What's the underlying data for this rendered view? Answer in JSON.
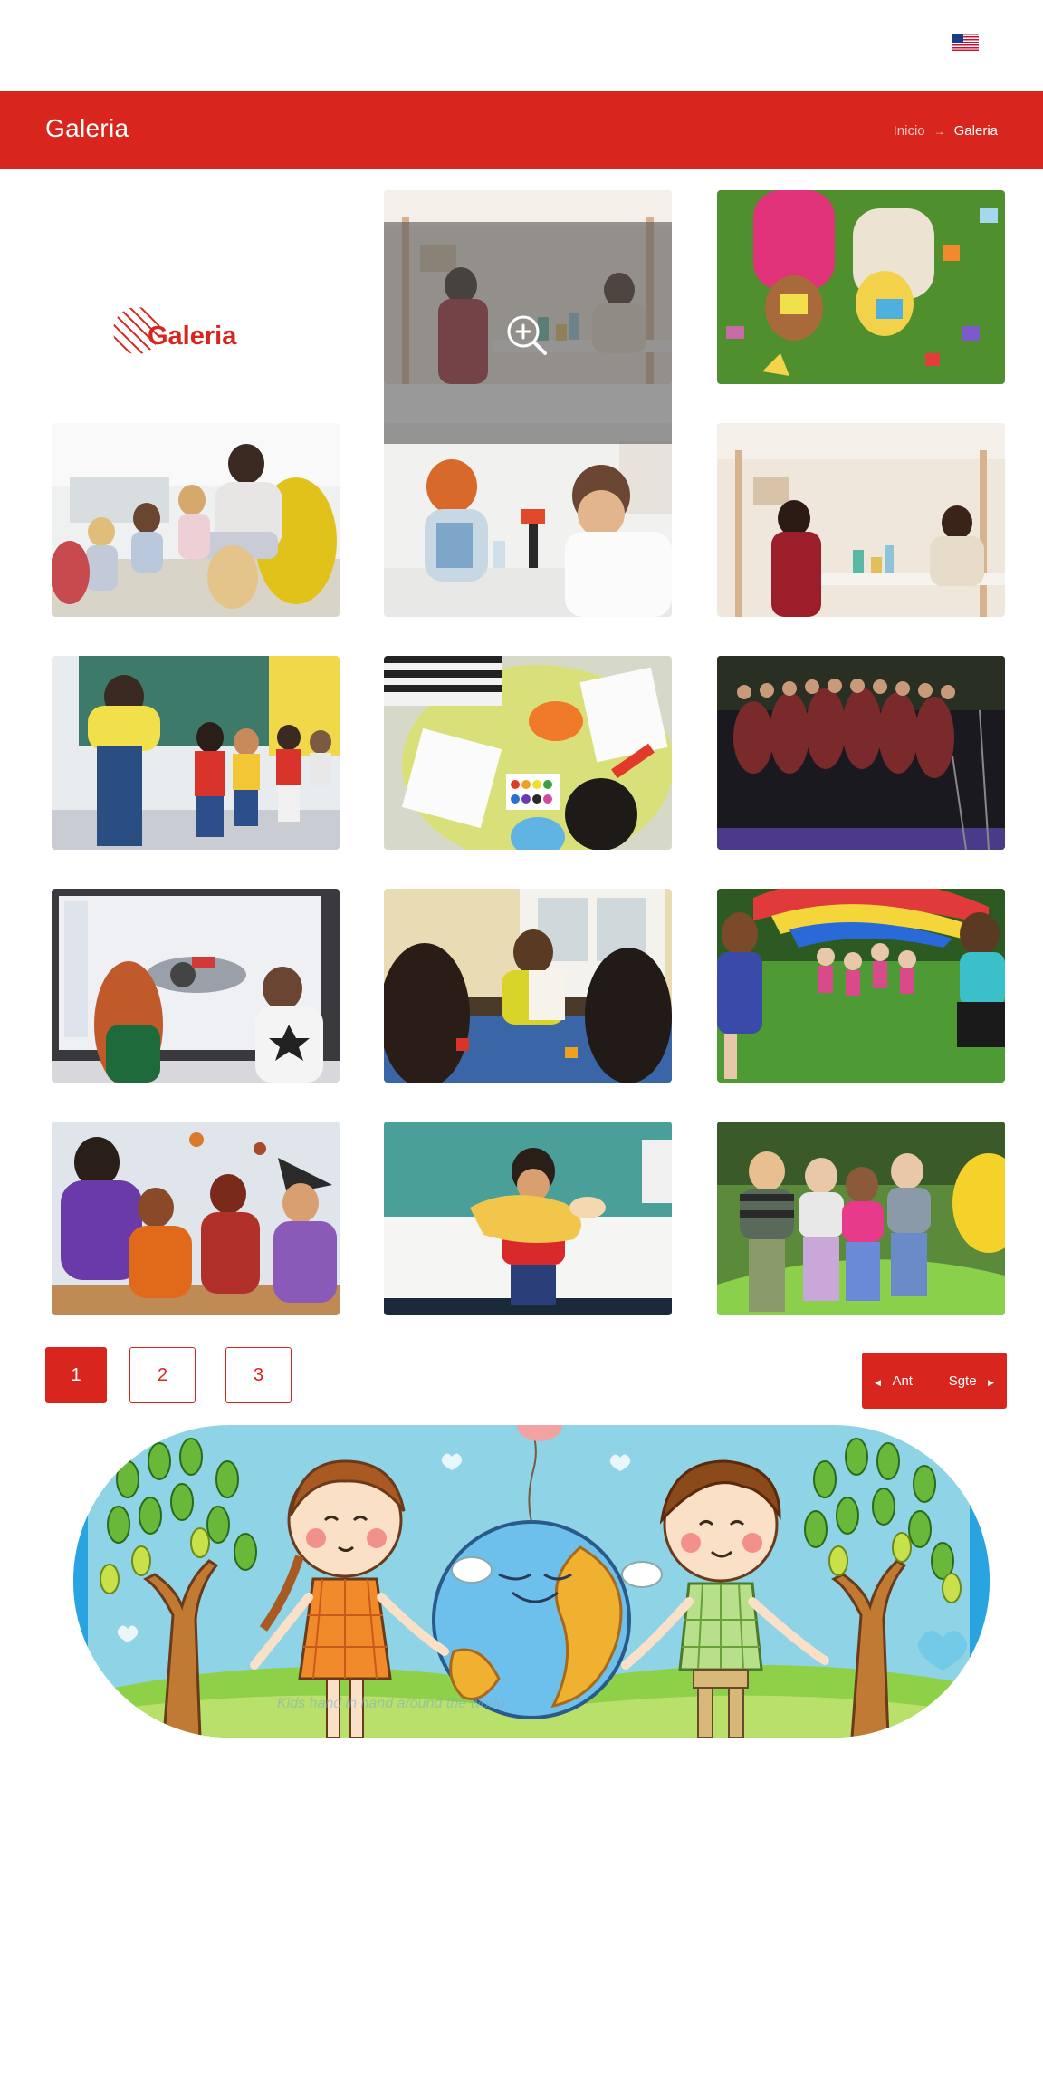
{
  "language_flag": {
    "icon": "us-flag-icon"
  },
  "header": {
    "title": "Galeria",
    "bg_color": "#d8251d"
  },
  "breadcrumb": {
    "home": "Inicio",
    "separator": "→",
    "current": "Galeria"
  },
  "gallery": {
    "logo_text": "Galeria",
    "items": [
      {
        "label": "children playing with wooden blocks at table"
      },
      {
        "label": "children lying on grass with toy blocks"
      },
      {
        "label": "teacher reading to kids"
      },
      {
        "label": "kids doing science with microscope"
      },
      {
        "label": "children playing with wooden blocks at table"
      },
      {
        "label": "kids lined up at chalkboard"
      },
      {
        "label": "children painting with watercolors"
      },
      {
        "label": "children choir performance"
      },
      {
        "label": "kids at interactive smartboard"
      },
      {
        "label": "teacher showing a book to children"
      },
      {
        "label": "kids playing with parachute on grass"
      },
      {
        "label": "children in costumes sitting on floor"
      },
      {
        "label": "boy holding a drawing in classroom"
      },
      {
        "label": "kids at bounce house"
      }
    ]
  },
  "pagination": {
    "pages": [
      "1",
      "2",
      "3"
    ],
    "active": "1",
    "prev": "Ant",
    "next": "Sgte"
  },
  "banner": {
    "caption": "Kids hand in hand around the world"
  }
}
